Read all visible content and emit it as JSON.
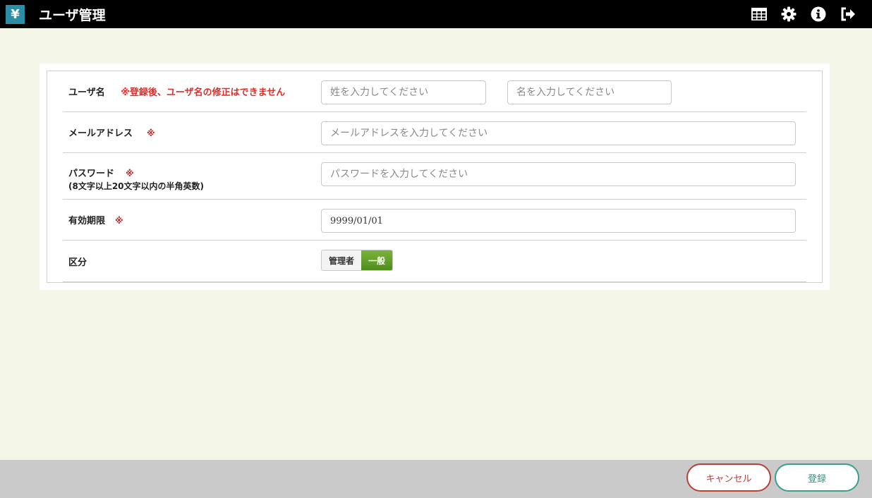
{
  "header": {
    "logo_glyph": "¥",
    "title": "ユーザ管理",
    "icons": [
      "table-icon",
      "gear-icon",
      "info-icon",
      "logout-icon"
    ]
  },
  "form": {
    "username": {
      "label": "ユーザ名",
      "note": "※登録後、ユーザ名の修正はできません",
      "last_placeholder": "姓を入力してください",
      "first_placeholder": "名を入力してください"
    },
    "email": {
      "label": "メールアドレス",
      "required_mark": "※",
      "placeholder": "メールアドレスを入力してください"
    },
    "password": {
      "label": "パスワード",
      "required_mark": "※",
      "hint": "(8文字以上20文字以内の半角英数)",
      "placeholder": "パスワードを入力してください"
    },
    "expiry": {
      "label": "有効期限",
      "required_mark": "※",
      "value": "9999/01/01"
    },
    "role": {
      "label": "区分",
      "options": [
        "管理者",
        "一般"
      ],
      "selected": "一般"
    }
  },
  "footer": {
    "cancel_label": "キャンセル",
    "submit_label": "登録"
  },
  "colors": {
    "header_bg": "#000000",
    "page_bg": "#f4f6e7",
    "required": "#d7302b",
    "selected_segment": "#5c9a22",
    "cancel": "#b8403a",
    "submit": "#3aa08c"
  }
}
